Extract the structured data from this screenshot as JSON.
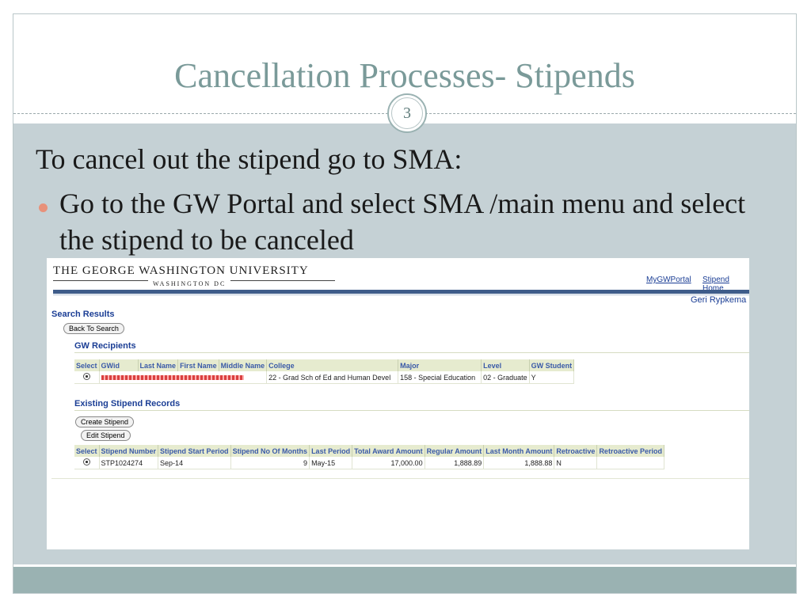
{
  "slide": {
    "title": "Cancellation Processes- Stipends",
    "page_number": "3",
    "intro": "To cancel out the stipend go to SMA:",
    "bullet": "Go to the GW Portal  and select SMA /main menu and select the stipend to be canceled"
  },
  "screenshot": {
    "logo_line1": "THE GEORGE WASHINGTON UNIVERSITY",
    "logo_line2": "WASHINGTON DC",
    "links": {
      "portal": "MyGWPortal",
      "stipend_home": "Stipend Home"
    },
    "user_name": "Geri Rypkema",
    "search_results_label": "Search Results",
    "back_button": "Back To Search",
    "recipients_label": "GW Recipients",
    "recipients_headers": [
      "Select",
      "GWid",
      "Last Name",
      "First Name",
      "Middle Name",
      "College",
      "Major",
      "Level",
      "GW Student"
    ],
    "recipient_row": {
      "college": "22 - Grad Sch of Ed and Human Devel",
      "major": "158 - Special Education",
      "level": "02 - Graduate",
      "gw_student": "Y"
    },
    "stipends_label": "Existing Stipend Records",
    "create_button": "Create Stipend",
    "edit_button": "Edit Stipend",
    "stipend_headers": [
      "Select",
      "Stipend Number",
      "Stipend Start Period",
      "Stipend No Of Months",
      "Last Period",
      "Total Award Amount",
      "Regular Amount",
      "Last Month Amount",
      "Retroactive",
      "Retroactive Period"
    ],
    "stipend_row": {
      "number": "STP1024274",
      "start_period": "Sep-14",
      "months": "9",
      "last_period": "May-15",
      "total": "17,000.00",
      "regular": "1,888.89",
      "last_month": "1,888.88",
      "retroactive": "N",
      "retro_period": ""
    }
  }
}
